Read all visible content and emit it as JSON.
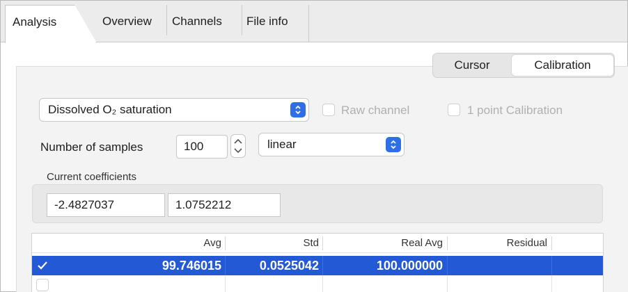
{
  "tabs": [
    {
      "label": "Analysis",
      "active": true
    },
    {
      "label": "Overview",
      "active": false
    },
    {
      "label": "Channels",
      "active": false
    },
    {
      "label": "File info",
      "active": false
    }
  ],
  "segmented": {
    "cursor_label": "Cursor",
    "calibration_label": "Calibration",
    "selected": "Calibration"
  },
  "channel_popup": {
    "value": "Dissolved O₂ saturation"
  },
  "raw_channel": {
    "label": "Raw channel",
    "checked": false,
    "enabled": false
  },
  "one_point": {
    "label": "1 point Calibration",
    "checked": false,
    "enabled": false
  },
  "samples": {
    "label": "Number of samples",
    "value": "100"
  },
  "fit_popup": {
    "value": "linear"
  },
  "coefficients": {
    "label": "Current coefficients",
    "values": [
      "-2.4827037",
      "1.0752212"
    ]
  },
  "table": {
    "headers": [
      "Avg",
      "Std",
      "Real Avg",
      "Residual"
    ],
    "rows": [
      {
        "checked": true,
        "avg": "99.746015",
        "std": "0.0525042",
        "real_avg": "100.000000",
        "residual": ""
      },
      {
        "checked": false,
        "avg": "",
        "std": "",
        "real_avg": "",
        "residual": ""
      }
    ]
  },
  "colors": {
    "accent": "#2e6ee6",
    "selection": "#2459d6"
  }
}
